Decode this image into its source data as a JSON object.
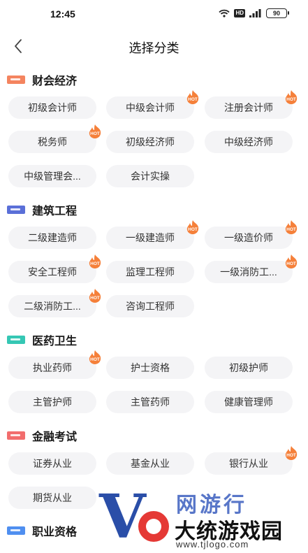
{
  "status_bar": {
    "time": "12:45",
    "hd": "HD",
    "battery": "90",
    "icons": [
      "wifi-icon",
      "signal-icon",
      "battery-icon"
    ]
  },
  "nav": {
    "title": "选择分类",
    "back_icon": "chevron-left-icon"
  },
  "hot_label": "HOT",
  "colors": {
    "hot": "#f5803a",
    "chip_bg": "#f4f4f6",
    "finance_icon": "#f4845f",
    "construction_icon": "#5a6fd8",
    "medical_icon": "#35c7b4",
    "banking_icon": "#f26d6d",
    "career_icon": "#4f8ff0"
  },
  "sections": [
    {
      "title": "财会经济",
      "items": [
        {
          "label": "初级会计师",
          "hot": false
        },
        {
          "label": "中级会计师",
          "hot": true
        },
        {
          "label": "注册会计师",
          "hot": true
        },
        {
          "label": "税务师",
          "hot": true
        },
        {
          "label": "初级经济师",
          "hot": false
        },
        {
          "label": "中级经济师",
          "hot": false
        },
        {
          "label": "中级管理会...",
          "hot": false
        },
        {
          "label": "会计实操",
          "hot": false
        }
      ]
    },
    {
      "title": "建筑工程",
      "items": [
        {
          "label": "二级建造师",
          "hot": false
        },
        {
          "label": "一级建造师",
          "hot": true
        },
        {
          "label": "一级造价师",
          "hot": true
        },
        {
          "label": "安全工程师",
          "hot": true
        },
        {
          "label": "监理工程师",
          "hot": false
        },
        {
          "label": "一级消防工...",
          "hot": true
        },
        {
          "label": "二级消防工...",
          "hot": true
        },
        {
          "label": "咨询工程师",
          "hot": false
        }
      ]
    },
    {
      "title": "医药卫生",
      "items": [
        {
          "label": "执业药师",
          "hot": true
        },
        {
          "label": "护士资格",
          "hot": false
        },
        {
          "label": "初级护师",
          "hot": false
        },
        {
          "label": "主管护师",
          "hot": false
        },
        {
          "label": "主管药师",
          "hot": false
        },
        {
          "label": "健康管理师",
          "hot": false
        }
      ]
    },
    {
      "title": "金融考试",
      "items": [
        {
          "label": "证券从业",
          "hot": false
        },
        {
          "label": "基金从业",
          "hot": false
        },
        {
          "label": "银行从业",
          "hot": true
        },
        {
          "label": "期货从业",
          "hot": false
        }
      ]
    },
    {
      "title": "职业资格",
      "items": []
    }
  ],
  "watermark": {
    "letter": "V",
    "top_text": "网游行",
    "name": "大统游戏园",
    "url": "www.tjlogo.com"
  }
}
